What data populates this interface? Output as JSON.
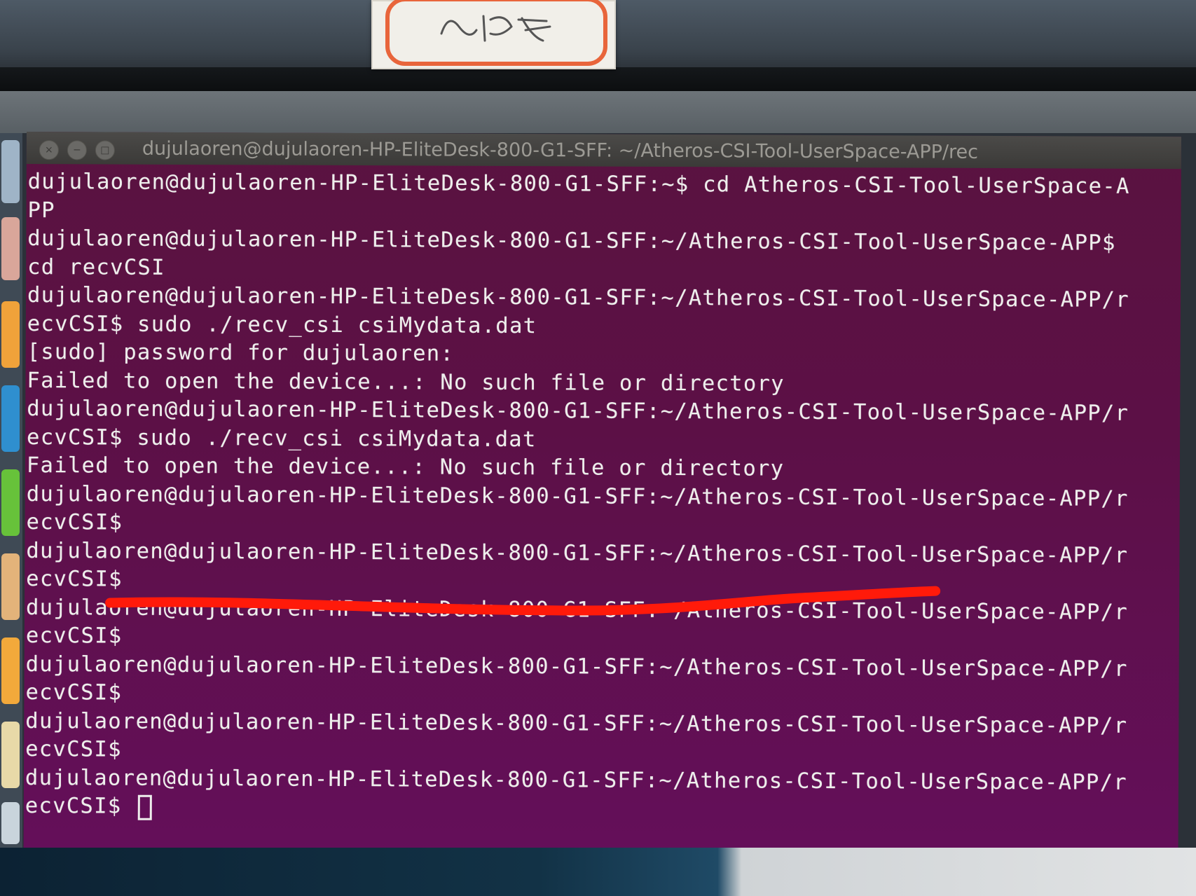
{
  "window": {
    "title": "dujulaoren@dujulaoren-HP-EliteDesk-800-G1-SFF: ~/Atheros-CSI-Tool-UserSpace-APP/rec",
    "buttons": {
      "close": "×",
      "minimize": "−",
      "maximize": "□"
    }
  },
  "sticker": {
    "handwriting": "项目组"
  },
  "terminal": {
    "lines": [
      "dujulaoren@dujulaoren-HP-EliteDesk-800-G1-SFF:~$ cd Atheros-CSI-Tool-UserSpace-A",
      "PP",
      "dujulaoren@dujulaoren-HP-EliteDesk-800-G1-SFF:~/Atheros-CSI-Tool-UserSpace-APP$",
      "cd recvCSI",
      "dujulaoren@dujulaoren-HP-EliteDesk-800-G1-SFF:~/Atheros-CSI-Tool-UserSpace-APP/r",
      "ecvCSI$ sudo ./recv_csi csiMydata.dat",
      "[sudo] password for dujulaoren:",
      "Failed to open the device...: No such file or directory",
      "dujulaoren@dujulaoren-HP-EliteDesk-800-G1-SFF:~/Atheros-CSI-Tool-UserSpace-APP/r",
      "ecvCSI$ sudo ./recv_csi csiMydata.dat",
      "Failed to open the device...: No such file or directory",
      "dujulaoren@dujulaoren-HP-EliteDesk-800-G1-SFF:~/Atheros-CSI-Tool-UserSpace-APP/r",
      "ecvCSI$",
      "dujulaoren@dujulaoren-HP-EliteDesk-800-G1-SFF:~/Atheros-CSI-Tool-UserSpace-APP/r",
      "ecvCSI$",
      "dujulaoren@dujulaoren-HP-EliteDesk-800-G1-SFF:~/Atheros-CSI-Tool-UserSpace-APP/r",
      "ecvCSI$",
      "dujulaoren@dujulaoren-HP-EliteDesk-800-G1-SFF:~/Atheros-CSI-Tool-UserSpace-APP/r",
      "ecvCSI$",
      "dujulaoren@dujulaoren-HP-EliteDesk-800-G1-SFF:~/Atheros-CSI-Tool-UserSpace-APP/r",
      "ecvCSI$",
      "dujulaoren@dujulaoren-HP-EliteDesk-800-G1-SFF:~/Atheros-CSI-Tool-UserSpace-APP/r",
      "ecvCSI$ "
    ]
  },
  "colors": {
    "terminal_bg": "#5c1046",
    "terminal_fg": "#eeeeec",
    "titlebar": "#3b3a38",
    "marker": "#ff1a0a"
  }
}
